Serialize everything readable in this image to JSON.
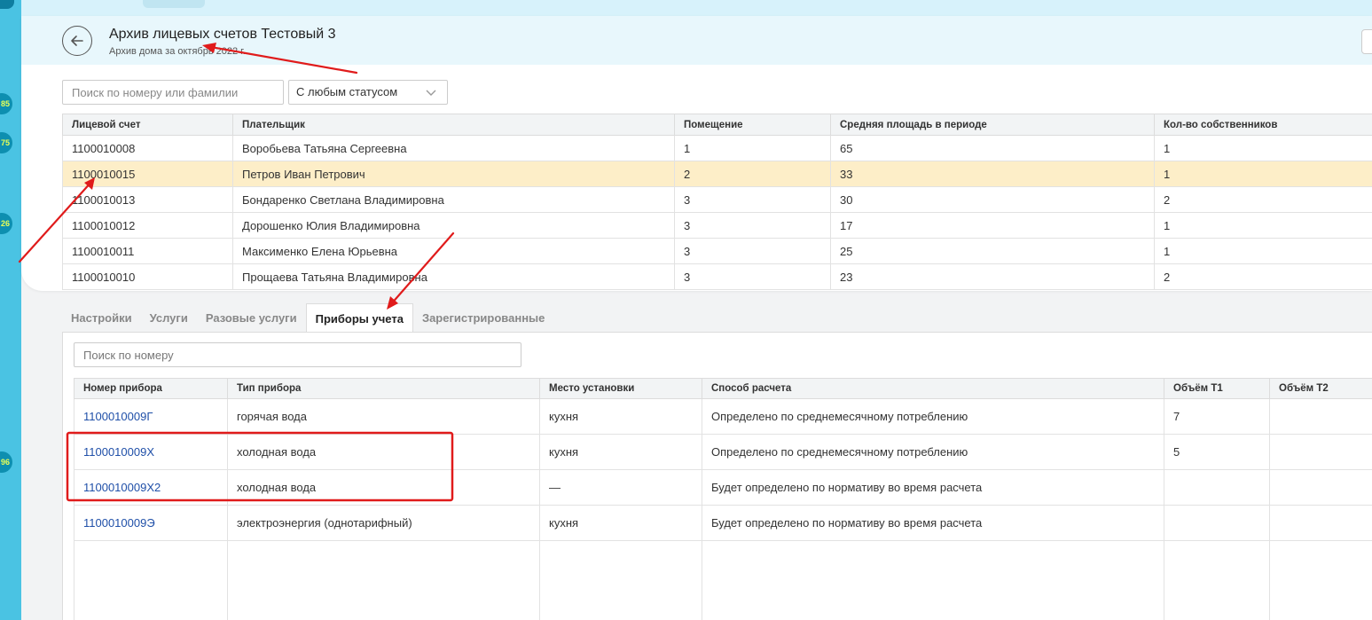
{
  "sidebar": {
    "badges": [
      "85",
      "75",
      "26",
      "96"
    ]
  },
  "header": {
    "title": "Архив лицевых счетов Тестовый 3",
    "subtitle": "Архив дома за октябрь 2022 г."
  },
  "filters": {
    "search_placeholder": "Поиск по номеру или фамилии",
    "status_value": "С любым статусом"
  },
  "accounts": {
    "columns": [
      "Лицевой счет",
      "Плательщик",
      "Помещение",
      "Средняя площадь в периоде",
      "Кол-во собственников"
    ],
    "rows": [
      [
        "1100010008",
        "Воробьева Татьяна Сергеевна",
        "1",
        "65",
        "1"
      ],
      [
        "1100010015",
        "Петров Иван Петрович",
        "2",
        "33",
        "1"
      ],
      [
        "1100010013",
        "Бондаренко Светлана Владимировна",
        "3",
        "30",
        "2"
      ],
      [
        "1100010012",
        "Дорошенко Юлия Владимировна",
        "3",
        "17",
        "1"
      ],
      [
        "1100010011",
        "Максименко Елена Юрьевна",
        "3",
        "25",
        "1"
      ],
      [
        "1100010010",
        "Прощаева Татьяна Владимировна",
        "3",
        "23",
        "2"
      ]
    ],
    "selected_row": 1
  },
  "tabs": [
    {
      "label": "Настройки",
      "active": false
    },
    {
      "label": "Услуги",
      "active": false
    },
    {
      "label": "Разовые услуги",
      "active": false
    },
    {
      "label": "Приборы учета",
      "active": true
    },
    {
      "label": "Зарегистрированные",
      "active": false
    }
  ],
  "meters": {
    "search_placeholder": "Поиск по номеру",
    "columns": [
      "Номер прибора",
      "Тип прибора",
      "Место установки",
      "Способ расчета",
      "Объём Т1",
      "Объём Т2"
    ],
    "rows": [
      [
        "1100010009Г",
        "горячая вода",
        "кухня",
        "Определено по среднемесячному потреблению",
        "7",
        ""
      ],
      [
        "1100010009Х",
        "холодная вода",
        "кухня",
        "Определено по среднемесячному потреблению",
        "5",
        ""
      ],
      [
        "1100010009Х2",
        "холодная вода",
        "—",
        "Будет определено по нормативу во время расчета",
        "",
        ""
      ],
      [
        "1100010009Э",
        "электроэнергия (однотарифный)",
        "кухня",
        "Будет определено по нормативу во время расчета",
        "",
        ""
      ]
    ]
  },
  "colors": {
    "sidebar": "#4ac3e3",
    "header_bg": "#e8f7fc",
    "selected_row": "#fdeec8",
    "link": "#1f4fa8",
    "annotation": "#e01b1b"
  }
}
